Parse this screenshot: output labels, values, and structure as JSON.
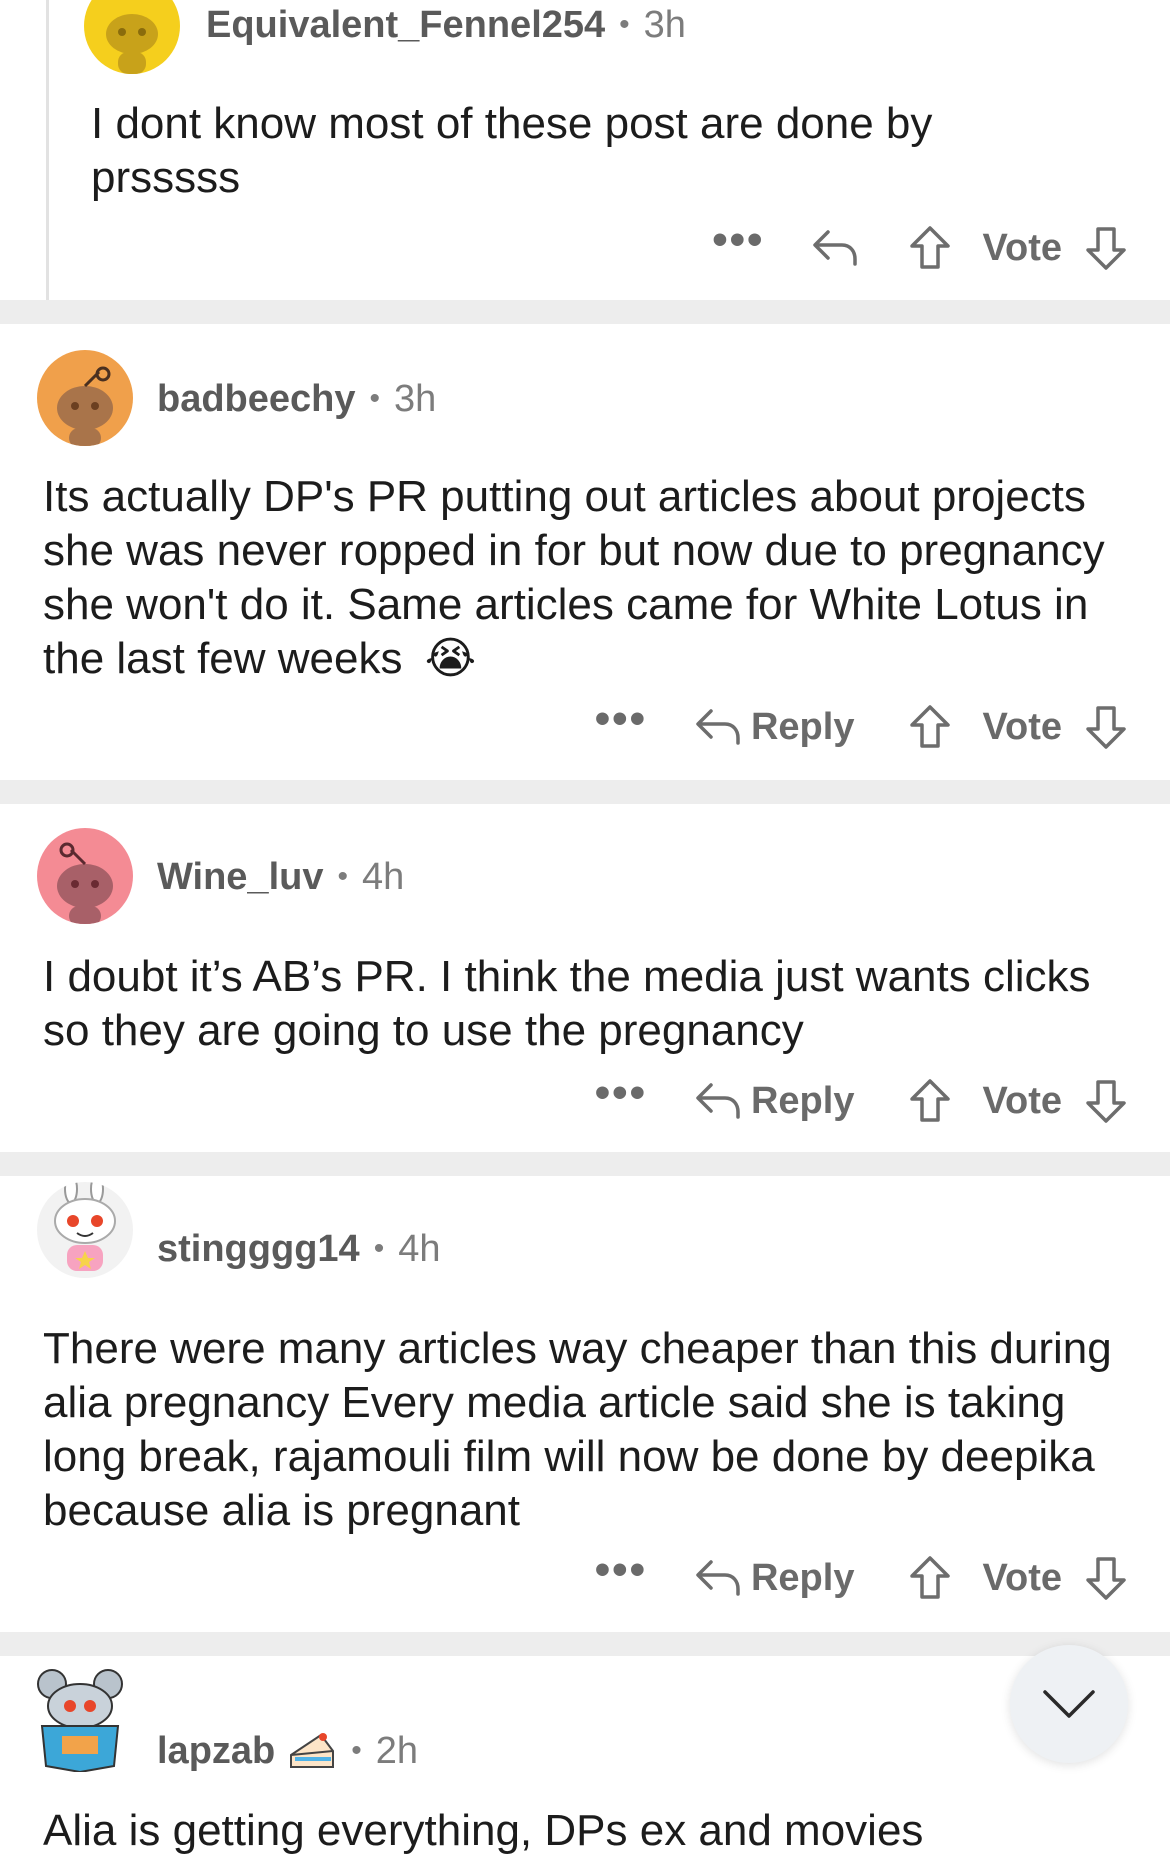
{
  "comments": [
    {
      "username": "Equivalent_Fennel254",
      "time": "3h",
      "body": "I dont know most of these post are done by prsssss",
      "more": "•••",
      "vote_label": "Vote"
    },
    {
      "username": "badbeechy",
      "time": "3h",
      "body": "Its actually DP's PR putting out articles about projects she was never ropped in for but now due to pregnancy she won't do it. Same articles came for White Lotus in the last few weeks",
      "emoji": "😭",
      "more": "•••",
      "reply_label": "Reply",
      "vote_label": "Vote"
    },
    {
      "username": "Wine_luv",
      "time": "4h",
      "body": "I doubt it’s AB’s PR. I think the media just wants clicks so they are going to use the pregnancy",
      "more": "•••",
      "reply_label": "Reply",
      "vote_label": "Vote"
    },
    {
      "username": "stingggg14",
      "time": "4h",
      "body": "There were many articles way cheaper than this during alia pregnancy Every media article said she is taking long break, rajamouli film will now be done by deepika because alia is pregnant",
      "more": "•••",
      "reply_label": "Reply",
      "vote_label": "Vote"
    },
    {
      "username": "lapzab",
      "time": "2h",
      "body": "Alia is getting everything, DPs ex and movies"
    }
  ],
  "meta_separator": "•",
  "icons": {
    "reply": "reply-arrow-icon",
    "upvote": "upvote-arrow-icon",
    "downvote": "downvote-arrow-icon",
    "scroll": "chevron-down-icon",
    "flair": "cake-icon"
  },
  "colors": {
    "separator": "#ededed",
    "meta_text": "#7c7c7c",
    "avatar_yellow": "#f5cf1d",
    "avatar_orange": "#f0a04b",
    "avatar_pink": "#f48b94"
  }
}
